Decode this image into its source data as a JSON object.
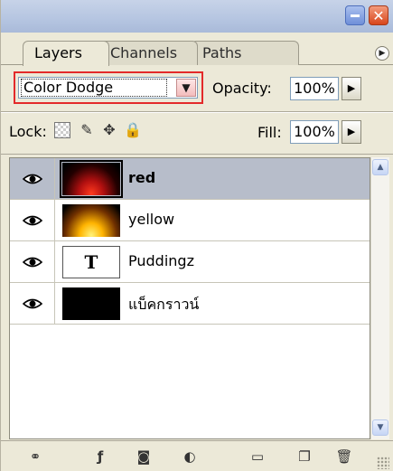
{
  "tabs": [
    {
      "label": "Layers",
      "active": true
    },
    {
      "label": "Channels",
      "active": false
    },
    {
      "label": "Paths",
      "active": false
    }
  ],
  "blend_mode": {
    "value": "Color Dodge"
  },
  "opacity": {
    "label": "Opacity:",
    "value": "100%"
  },
  "lock": {
    "label": "Lock:",
    "icons": [
      "lock-transparent-pixels-icon",
      "lock-image-pixels-brush-icon",
      "lock-position-move-icon",
      "lock-all-padlock-icon"
    ]
  },
  "fill": {
    "label": "Fill:",
    "value": "100%"
  },
  "layers": [
    {
      "name": "red",
      "visible": true,
      "selected": true,
      "thumbnail": "fire-red"
    },
    {
      "name": "yellow",
      "visible": true,
      "selected": false,
      "thumbnail": "fire-yellow"
    },
    {
      "name": "Puddingz",
      "visible": true,
      "selected": false,
      "thumbnail": "type-layer"
    },
    {
      "name": "แบ็คกราวน์",
      "visible": true,
      "selected": false,
      "thumbnail": "black-fill"
    }
  ],
  "bottom_tools": [
    "link-layers-icon",
    "layer-style-icon",
    "layer-mask-icon",
    "adjustment-layer-icon",
    "new-group-folder-icon",
    "new-layer-icon",
    "delete-layer-trash-icon"
  ],
  "colors": {
    "highlight": "#e32a2a",
    "selected_row": "#b7bdca",
    "panel_bg": "#ece9d8"
  }
}
